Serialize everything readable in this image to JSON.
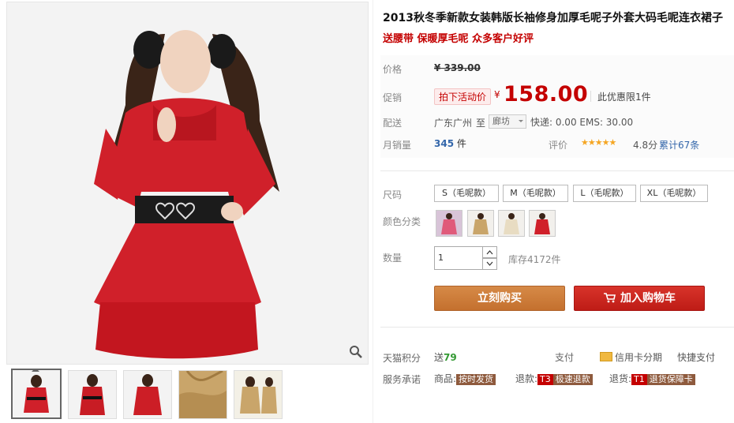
{
  "product": {
    "title": "2013秋冬季新款女装韩版长袖修身加厚毛呢子外套大码毛呢连衣裙子",
    "subtitle": "送腰带 保暖厚毛呢 众多客户好评"
  },
  "price": {
    "label": "价格",
    "original": "¥ 339.00",
    "promo_label": "促销",
    "promo_badge": "拍下活动价",
    "yen": "¥",
    "promo_price": "158.00",
    "limit_text": "此优惠限1件"
  },
  "delivery": {
    "label": "配送",
    "from": "广东广州",
    "to_text": "至",
    "destination": "廊坊",
    "shipping": "快递: 0.00 EMS: 30.00"
  },
  "sales": {
    "label": "月销量",
    "count": "345",
    "unit": "件",
    "rating_label": "评价",
    "stars": "★★★★★",
    "score": "4.8分",
    "reviews": "累计67条"
  },
  "sizes": {
    "label": "尺码",
    "options": [
      "S（毛呢款）",
      "M（毛呢款）",
      "L（毛呢款）",
      "XL（毛呢款）"
    ]
  },
  "colors": {
    "label": "颜色分类"
  },
  "quantity": {
    "label": "数量",
    "value": "1",
    "stock": "库存4172件"
  },
  "actions": {
    "buy_now": "立刻购买",
    "add_to_cart": "加入购物车"
  },
  "footer": {
    "points_label": "天猫积分",
    "points_prefix": "送",
    "points_value": "79",
    "pay_label": "支付",
    "credit_installment": "信用卡分期",
    "quick_pay": "快捷支付",
    "service_label": "服务承诺",
    "goods_label": "商品:",
    "goods_tag": "按时发货",
    "refund_label": "退款:",
    "refund_code": "T3",
    "refund_tag": "极速退款",
    "return_label": "退货:",
    "return_code": "T1",
    "return_tag": "退货保障卡"
  },
  "colors_palette": {
    "accent_red": "#c40000",
    "buy_orange": "#c4702e",
    "cart_red": "#be1c16"
  }
}
